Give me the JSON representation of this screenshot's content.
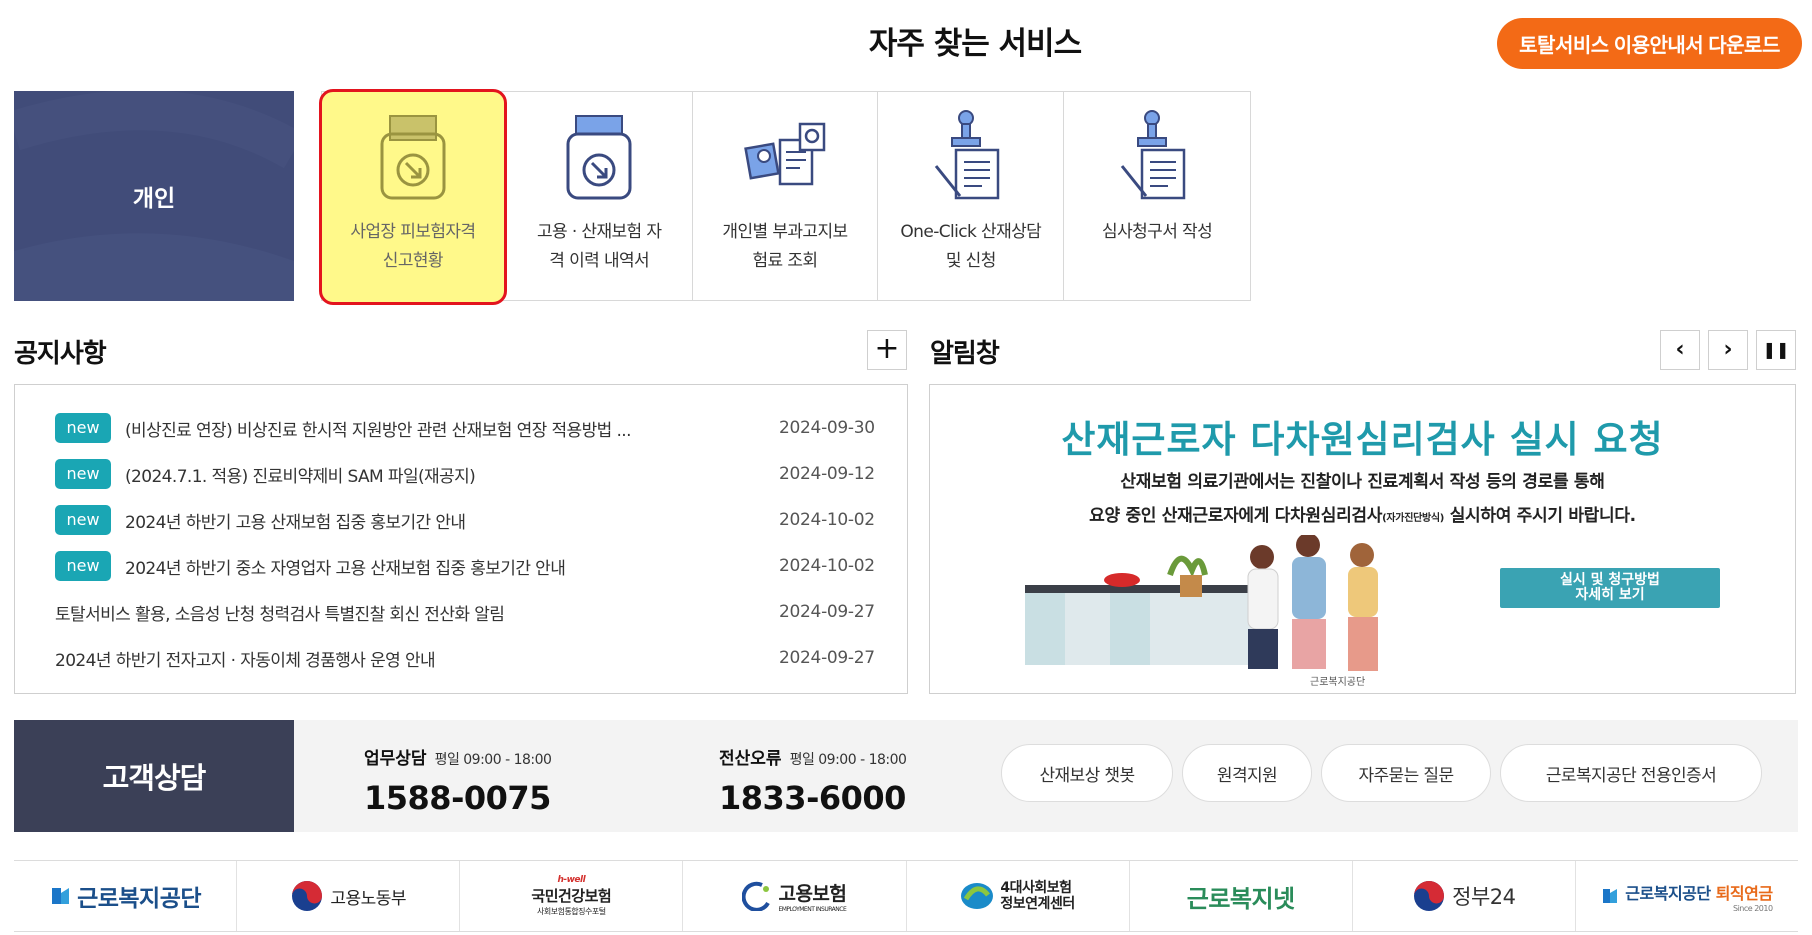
{
  "header": {
    "title": "자주 찾는 서비스",
    "guide_button": "토탈서비스 이용안내서 다운로드"
  },
  "personal_label": "개인",
  "services": [
    {
      "line1": "사업장 피보험자격",
      "line2": "신고현황",
      "icon": "printer-arrow-icon"
    },
    {
      "line1": "고용 · 산재보험 자",
      "line2": "격 이력 내역서",
      "icon": "document-arrow-icon"
    },
    {
      "line1": "개인별 부과고지보",
      "line2": "험료 조회",
      "icon": "search-receipt-icon"
    },
    {
      "line1": "One-Click 산재상담",
      "line2": "및 신청",
      "icon": "stamp-document-icon"
    },
    {
      "line1": "심사청구서 작성",
      "line2": "",
      "icon": "stamp-document-icon"
    }
  ],
  "notice": {
    "title": "공지사항",
    "more_label": "+",
    "items": [
      {
        "badge": "new",
        "text": "(비상진료 연장) 비상진료 한시적 지원방안 관련 산재보험 연장 적용방법 ...",
        "date": "2024-09-30"
      },
      {
        "badge": "new",
        "text": "(2024.7.1. 적용) 진료비약제비 SAM 파일(재공지)",
        "date": "2024-09-12"
      },
      {
        "badge": "new",
        "text": "2024년 하반기 고용 산재보험 집중 홍보기간 안내",
        "date": "2024-10-02"
      },
      {
        "badge": "new",
        "text": "2024년 하반기 중소 자영업자 고용 산재보험 집중 홍보기간 안내",
        "date": "2024-10-02"
      },
      {
        "badge": "",
        "text": "토탈서비스 활용, 소음성 난청 청력검사 특별진찰 회신 전산화 알림",
        "date": "2024-09-27"
      },
      {
        "badge": "",
        "text": "2024년 하반기 전자고지 · 자동이체 경품행사 운영 안내",
        "date": "2024-09-27"
      }
    ]
  },
  "alert": {
    "title": "알림창",
    "prev_label": "‹",
    "next_label": "›",
    "pause_label": "❚❚",
    "banner_title": "산재근로자 다차원심리검사 실시 요청",
    "line1": "산재보험 의료기관에서는 진찰이나 진료계획서 작성 등의 경로를 통해",
    "line2_a": "요양 중인 산재근로자에게 다차원심리검사",
    "line2_small": "(자가진단방식)",
    "line2_b": " 실시하여 주시기 바랍니다.",
    "button_line1": "실시 및 청구방법",
    "button_line2": "자세히 보기",
    "org": "근로복지공단"
  },
  "consult": {
    "label": "고객상담",
    "items": [
      {
        "name": "업무상담",
        "hours": "평일 09:00 - 18:00",
        "phone": "1588-0075"
      },
      {
        "name": "전산오류",
        "hours": "평일 09:00 - 18:00",
        "phone": "1833-6000"
      }
    ],
    "links": [
      "산재보상 챗봇",
      "원격지원",
      "자주묻는 질문",
      "근로복지공단 전용인증서"
    ]
  },
  "footer": {
    "links": [
      {
        "label": "근로복지공단"
      },
      {
        "label": "고용노동부"
      },
      {
        "label": "국민건강보험",
        "sub": "사회보험통합징수포털",
        "pre": "h-well"
      },
      {
        "label": "고용보험",
        "sub": "EMPLOYMENT INSURANCE"
      },
      {
        "label": "4대사회보험",
        "label2": "정보연계센터"
      },
      {
        "label": "근로복지넷"
      },
      {
        "label": "정부24"
      },
      {
        "label": "근로복지공단",
        "accent": "퇴직연금",
        "sub": "Since 2010"
      }
    ]
  },
  "colors": {
    "accent_orange": "#f36a16",
    "personal_bg": "#414c79",
    "highlight_yellow": "#fff98a",
    "highlight_border": "#e3141e",
    "badge_teal": "#1aa6b4",
    "consult_dark": "#3b4057"
  }
}
